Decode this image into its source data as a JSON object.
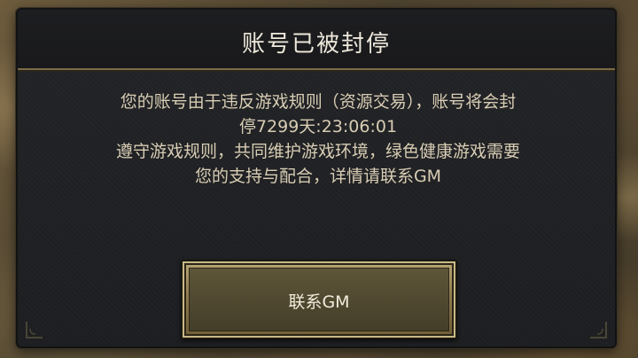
{
  "dialog": {
    "title": "账号已被封停",
    "message_lines": [
      "您的账号由于违反游戏规则（资源交易），账号将会封",
      "停7299天:23:06:01",
      "遵守游戏规则，共同维护游戏环境，绿色健康游戏需要",
      "您的支持与配合，详情请联系GM"
    ],
    "contact_button_label": "联系GM"
  },
  "colors": {
    "title_text": "#efe9dc",
    "body_text": "#d8cdb4",
    "panel_bg": "#1f2023",
    "accent_gold": "#8e7c4f"
  }
}
